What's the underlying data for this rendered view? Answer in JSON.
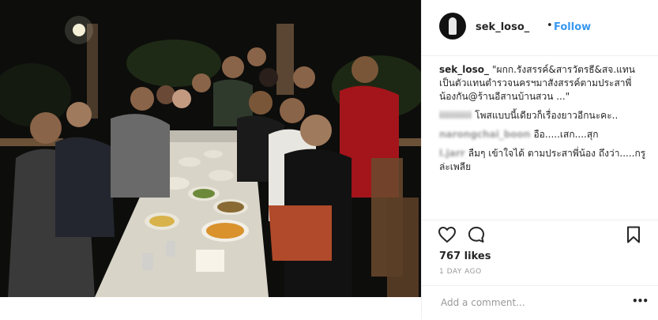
{
  "post": {
    "username": "sek_loso_",
    "separator": "•",
    "follow_label": "Follow"
  },
  "comments": [
    {
      "user": "sek_loso_",
      "text": "\"ผกก.รังสรรค์&สารวัตรธี&สจ.แทน เป็นตัวแทนตำรวจนครฯมาสังสรรค์ตามประสาพี่น้องกัน@ร้านอีสานบ้านสวน ...\""
    },
    {
      "user": "iiiiiiiiii",
      "text": "โพสแบบนี้เดียวก็เรื่องยาวอีกนะคะ.."
    },
    {
      "user": "narongchai_boon",
      "text": "อือ.....เสก....สุก"
    },
    {
      "user": "l.jarr",
      "text": "ลืมๆ เข้าใจได้ ตามประสาพี่น้อง ถึงว่า.....กรูล่ะเพลีย"
    }
  ],
  "stats": {
    "likes": "767 likes",
    "time_ago": "1 DAY AGO"
  },
  "composer": {
    "placeholder": "Add a comment...",
    "more_label": "•••"
  },
  "icons": {
    "avatar": "profile-avatar",
    "like": "heart-icon",
    "comment": "speech-bubble-icon",
    "save": "bookmark-icon",
    "more": "more-options-icon"
  },
  "colors": {
    "link_blue": "#3897f0",
    "text": "#262626",
    "muted": "#999999",
    "divider": "#efefef"
  }
}
